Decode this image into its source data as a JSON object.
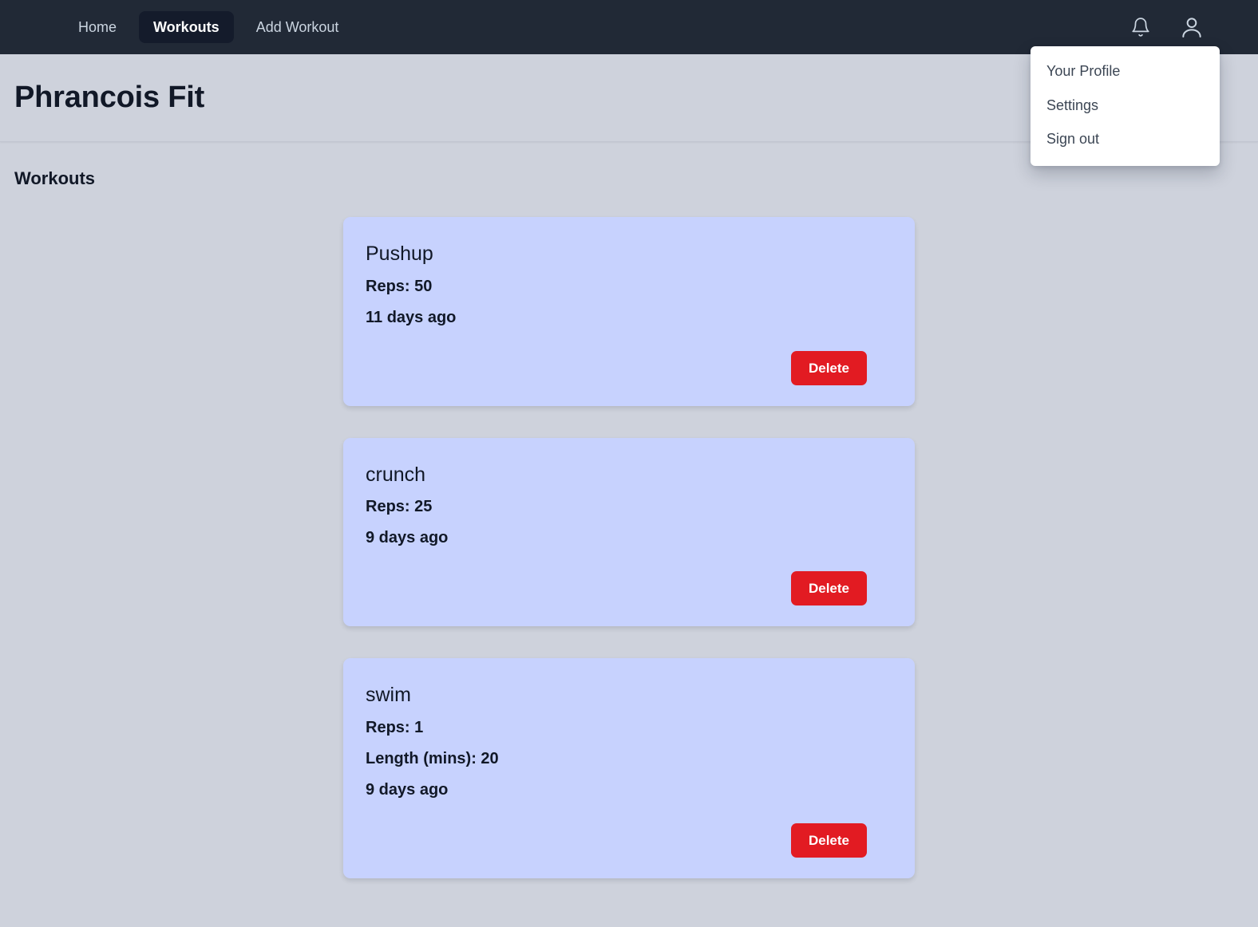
{
  "navbar": {
    "links": [
      {
        "label": "Home",
        "active": false
      },
      {
        "label": "Workouts",
        "active": true
      },
      {
        "label": "Add Workout",
        "active": false
      }
    ],
    "notifications_icon": "bell-icon",
    "profile_icon": "user-avatar-icon"
  },
  "profile_menu": {
    "items": [
      {
        "label": "Your Profile"
      },
      {
        "label": "Settings"
      },
      {
        "label": "Sign out"
      }
    ]
  },
  "header": {
    "title": "Phrancois Fit"
  },
  "main": {
    "section_title": "Workouts",
    "delete_label": "Delete",
    "cards": [
      {
        "title": "Pushup",
        "reps": "Reps: 50",
        "length": "",
        "time": "11 days ago"
      },
      {
        "title": "crunch",
        "reps": "Reps: 25",
        "length": "",
        "time": "9 days ago"
      },
      {
        "title": "swim",
        "reps": "Reps: 1",
        "length": "Length (mins): 20",
        "time": "9 days ago"
      }
    ]
  },
  "colors": {
    "navbar_bg": "#212936",
    "active_pill_bg": "#141b2b",
    "page_bg": "#ced2dc",
    "card_bg": "#c7d2fe",
    "delete_red": "#e21b22",
    "menu_bg": "#ffffff"
  }
}
